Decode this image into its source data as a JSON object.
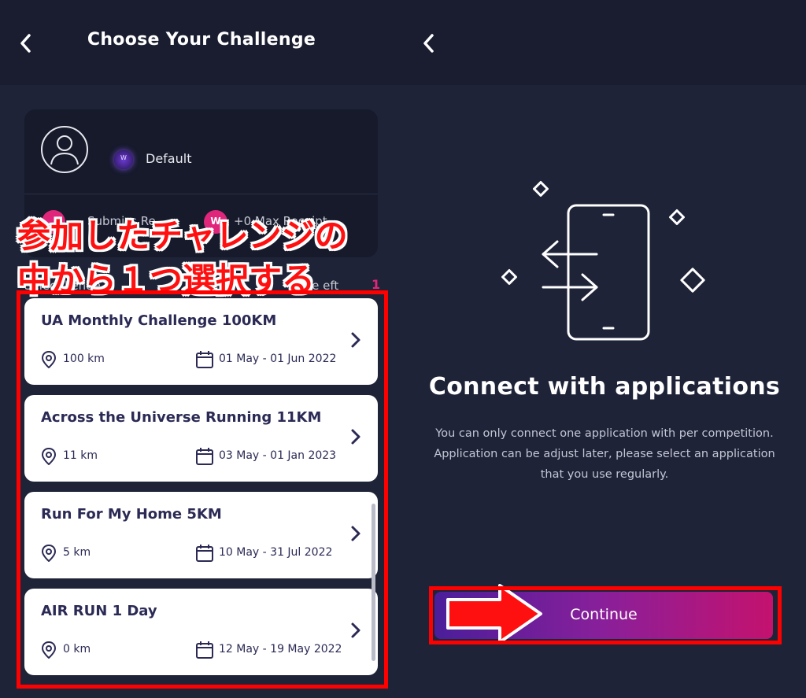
{
  "left": {
    "header": {
      "title": "Choose Your Challenge"
    },
    "profile": {
      "badge_text": "W",
      "level": "Default",
      "stat1": "Submiss   Re",
      "stat2_icon": "W",
      "stat2": "+0   Max Receipt"
    },
    "section": {
      "left": "Select   llenge",
      "right": "ss   Re   eft",
      "count": "1"
    },
    "annotation": {
      "line1": "参加したチャレンジの",
      "line2": "中から１つ選択する"
    },
    "challenges": [
      {
        "title": "UA Monthly Challenge 100KM",
        "distance": "100 km",
        "dates": "01 May - 01 Jun 2022"
      },
      {
        "title": "Across the Universe Running 11KM",
        "distance": "11 km",
        "dates": "03 May - 01 Jan 2023"
      },
      {
        "title": "Run For My Home 5KM",
        "distance": "5 km",
        "dates": "10 May - 31 Jul 2022"
      },
      {
        "title": "AIR RUN 1 Day",
        "distance": "0 km",
        "dates": "12 May - 19 May 2022"
      }
    ]
  },
  "right": {
    "title": "Connect with applications",
    "description": [
      "You can only connect one application with per competition.",
      "Application can be adjust later, please select an application",
      "that you use regularly."
    ],
    "button": "Continue"
  },
  "colors": {
    "background": "#1e2338",
    "accent": "#e0267b",
    "annotation": "#ff0000"
  }
}
